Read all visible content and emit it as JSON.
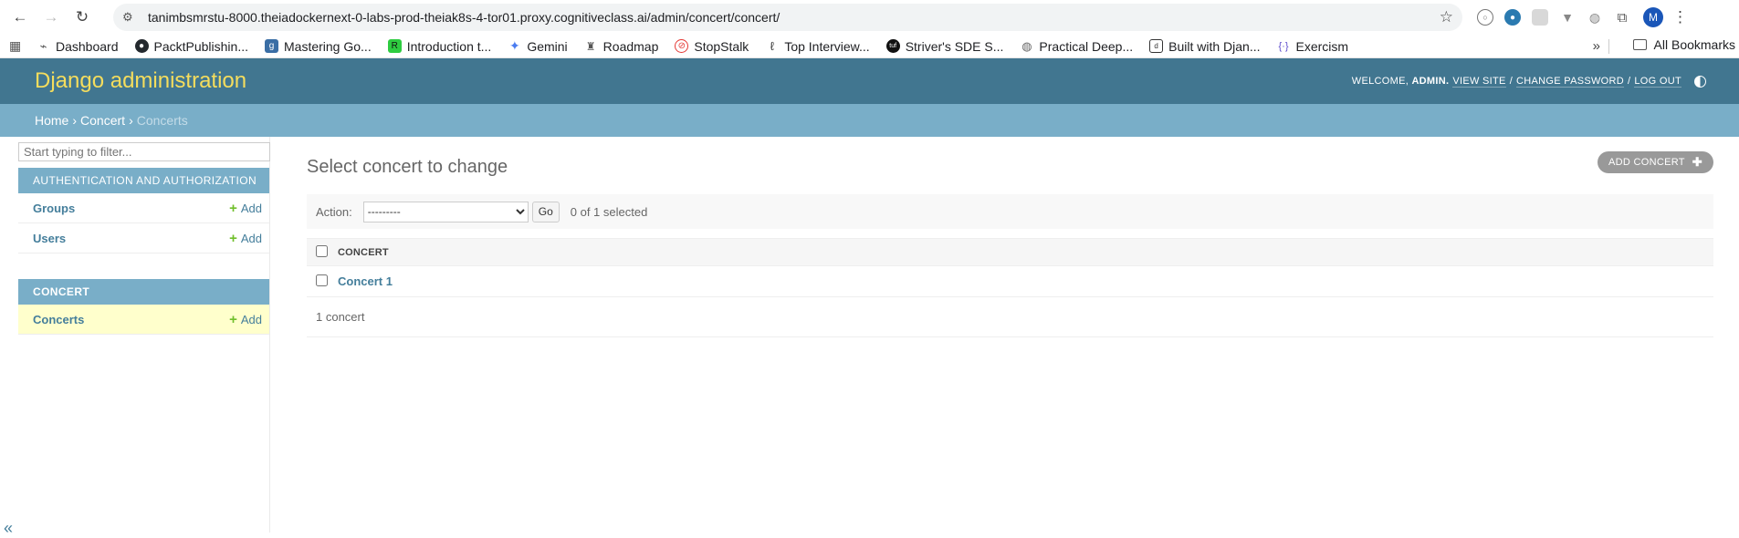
{
  "browser": {
    "url": "tanimbsmrstu-8000.theiadockernext-0-labs-prod-theiak8s-4-tor01.proxy.cognitiveclass.ai/admin/concert/concert/",
    "profile_initial": "M",
    "bookmarks": [
      {
        "label": "Dashboard",
        "icon": "dashboard-icon",
        "color": "#555555"
      },
      {
        "label": "PacktPublishin...",
        "icon": "github-icon",
        "color": "#24292e"
      },
      {
        "label": "Mastering Go...",
        "icon": "gopher-icon",
        "color": "#3a6ea5"
      },
      {
        "label": "Introduction t...",
        "icon": "rc-icon",
        "color": "#2ecc40"
      },
      {
        "label": "Gemini",
        "icon": "gemini-icon",
        "color": "#4a7cf0"
      },
      {
        "label": "Roadmap",
        "icon": "roadmap-icon",
        "color": "#555555"
      },
      {
        "label": "StopStalk",
        "icon": "stopstalk-icon",
        "color": "#e53935"
      },
      {
        "label": "Top Interview...",
        "icon": "leetcode-icon",
        "color": "#333333"
      },
      {
        "label": "Striver's SDE S...",
        "icon": "tuf-icon",
        "color": "#111111"
      },
      {
        "label": "Practical Deep...",
        "icon": "globe-icon",
        "color": "#666666"
      },
      {
        "label": "Built with Djan...",
        "icon": "django-icon",
        "color": "#0c4b33"
      },
      {
        "label": "Exercism",
        "icon": "exercism-icon",
        "color": "#604fcd"
      }
    ],
    "all_bookmarks": "All Bookmarks"
  },
  "header": {
    "branding": "Django administration",
    "welcome": "Welcome,",
    "username": "admin.",
    "view_site": "View site",
    "change_password": "Change password",
    "log_out": "Log out"
  },
  "breadcrumbs": {
    "home": "Home",
    "app": "Concert",
    "current": "Concerts",
    "separator": "›"
  },
  "sidebar": {
    "filter_placeholder": "Start typing to filter...",
    "apps": [
      {
        "caption": "Authentication and Authorization",
        "models": [
          {
            "name": "Groups",
            "add": "Add"
          },
          {
            "name": "Users",
            "add": "Add"
          }
        ]
      },
      {
        "caption": "Concert",
        "models": [
          {
            "name": "Concerts",
            "add": "Add",
            "active": true
          }
        ]
      }
    ],
    "toggle_glyph": "«"
  },
  "content": {
    "title": "Select concert to change",
    "add_button": "Add concert",
    "action_label": "Action:",
    "action_selected": "---------",
    "go_button": "Go",
    "selected_counter": "0 of 1 selected",
    "table": {
      "columns": [
        "Concert"
      ],
      "rows": [
        {
          "concert": "Concert 1"
        }
      ]
    },
    "paginator": "1 concert"
  },
  "colors": {
    "header_bg": "#417690",
    "branding": "#f5dd5d",
    "breadcrumbs_bg": "#79aec8",
    "link": "#447e9b",
    "add_plus": "#70bf2b",
    "active_row": "#ffffcc"
  }
}
